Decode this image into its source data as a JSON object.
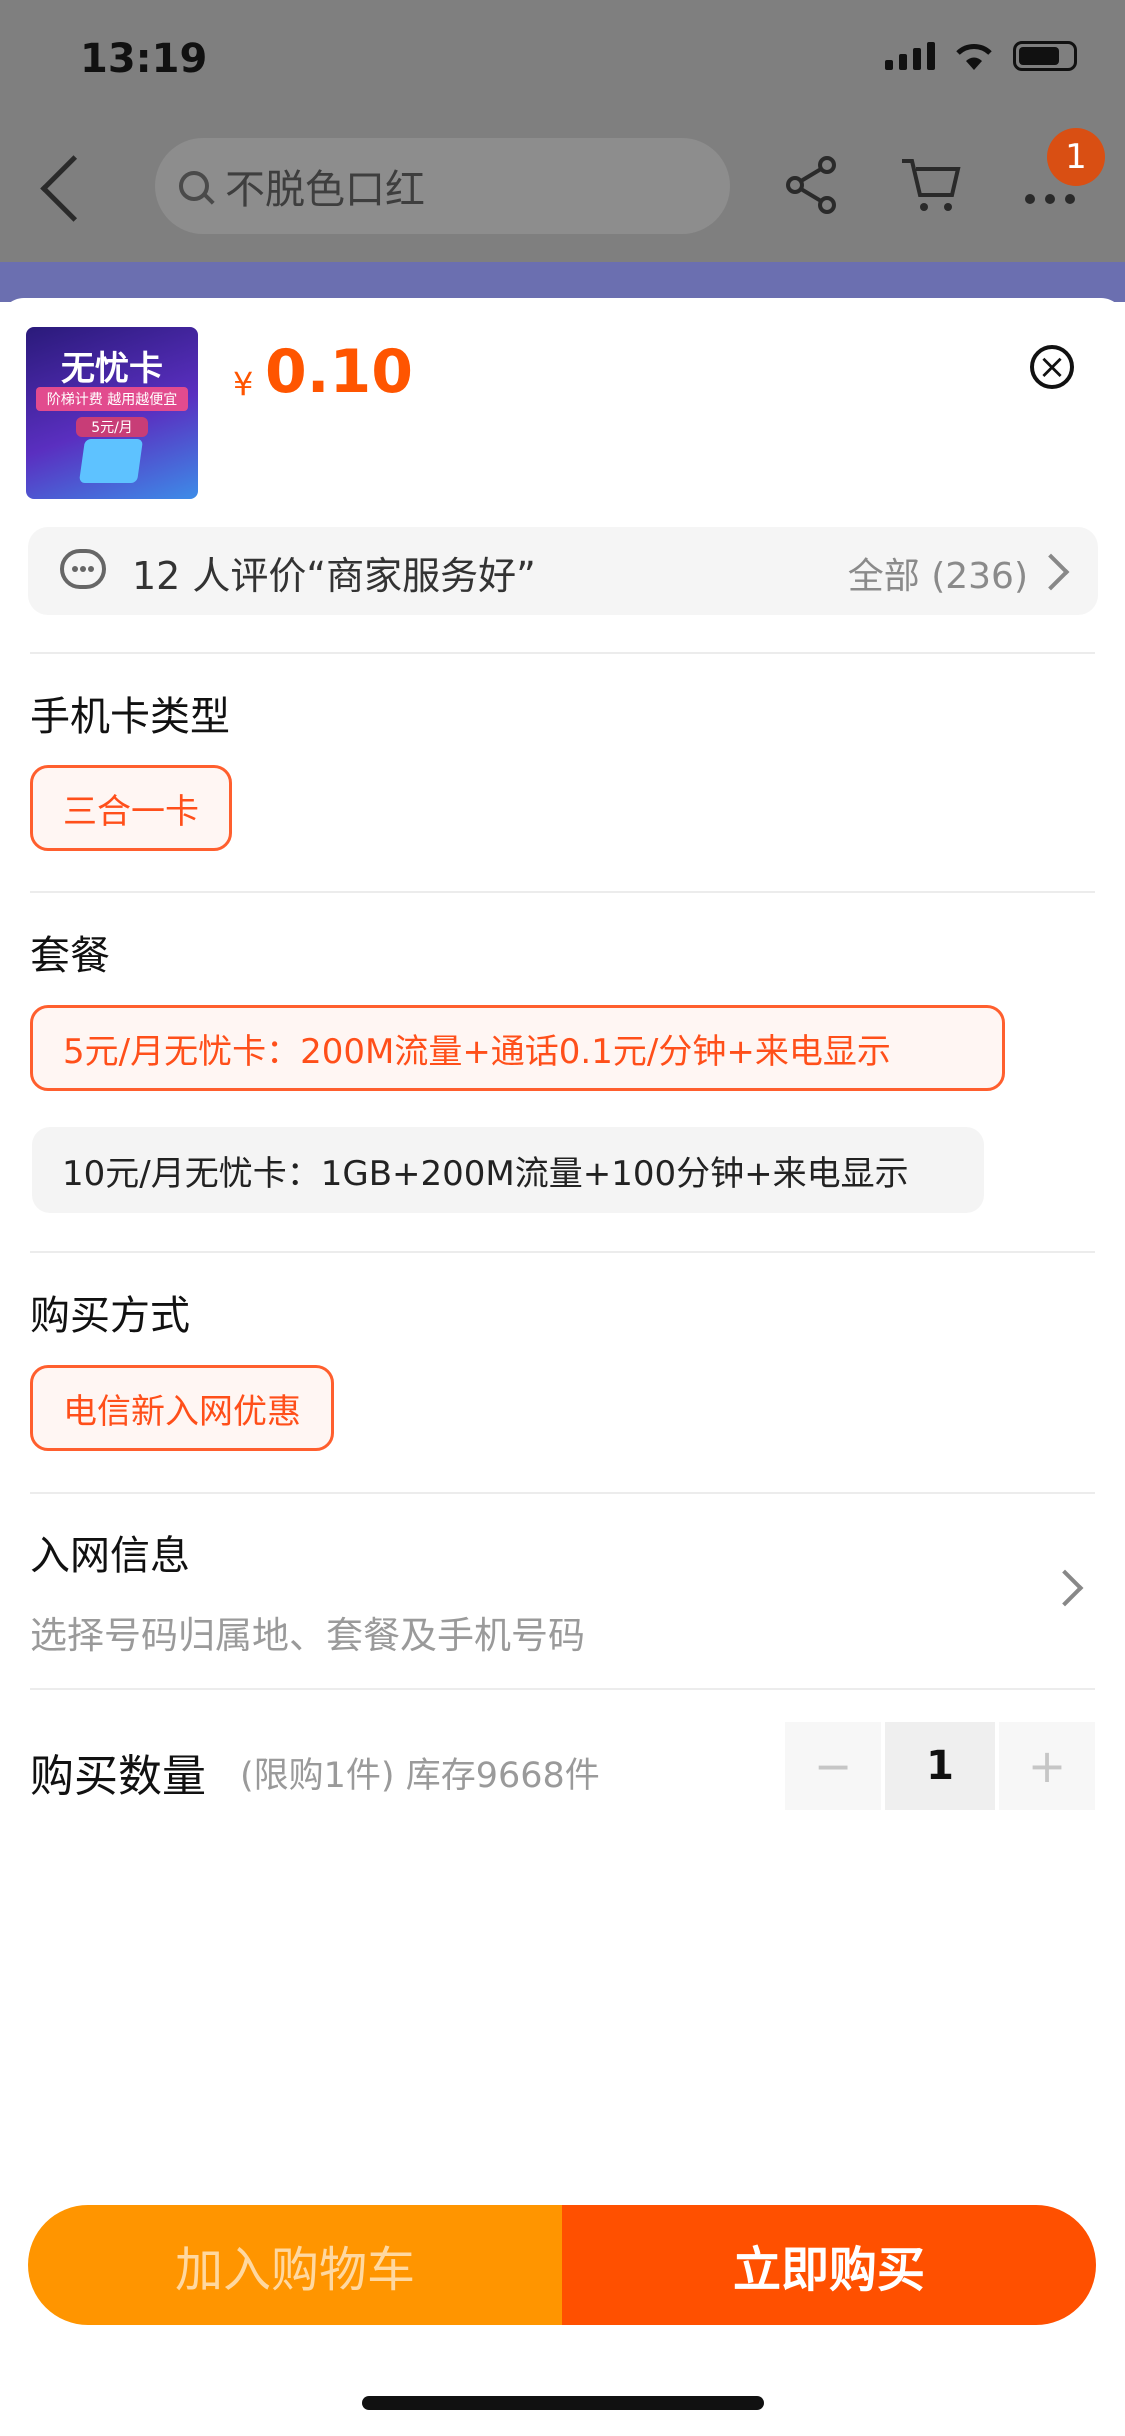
{
  "status_bar": {
    "time": "13:19"
  },
  "background_page": {
    "search_placeholder": "不脱色口红",
    "cart_badge": "1"
  },
  "sku_sheet": {
    "thumbnail": {
      "title": "无忧卡",
      "subtitle": "阶梯计费 越用越便宜",
      "tag": "5元/月"
    },
    "price_symbol": "¥",
    "price": "0.10",
    "review": {
      "text": "12 人评价“商家服务好”",
      "all_label": "全部 (236)"
    },
    "sections": {
      "card_type": {
        "title": "手机卡类型",
        "options": [
          "三合一卡"
        ],
        "selected": 0
      },
      "plan": {
        "title": "套餐",
        "options": [
          "5元/月无忧卡：200M流量+通话0.1元/分钟+来电显示",
          "10元/月无忧卡：1GB+200M流量+100分钟+来电显示"
        ],
        "selected": 0
      },
      "purchase_method": {
        "title": "购买方式",
        "options": [
          "电信新入网优惠"
        ],
        "selected": 0
      },
      "network_info": {
        "title": "入网信息",
        "subtitle": "选择号码归属地、套餐及手机号码"
      },
      "quantity": {
        "title": "购买数量",
        "note": "(限购1件) 库存9668件",
        "value": "1",
        "minus": "−",
        "plus": "+"
      }
    },
    "actions": {
      "add_to_cart": "加入购物车",
      "buy_now": "立即购买"
    }
  },
  "colors": {
    "accent": "#ff5000",
    "cart_button": "#ff9500",
    "selected_border": "#ff5f2e"
  }
}
